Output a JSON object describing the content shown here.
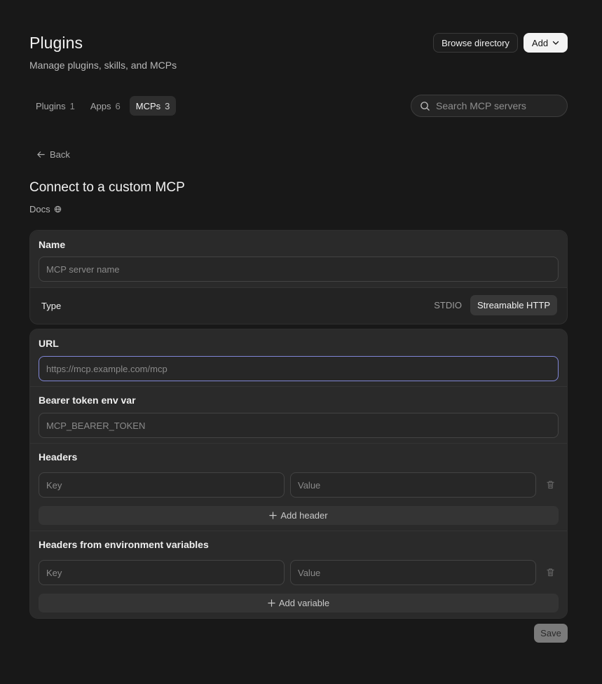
{
  "header": {
    "title": "Plugins",
    "subtitle": "Manage plugins, skills, and MCPs",
    "browse_label": "Browse directory",
    "add_label": "Add"
  },
  "tabs": [
    {
      "label": "Plugins",
      "count": "1",
      "active": false
    },
    {
      "label": "Apps",
      "count": "6",
      "active": false
    },
    {
      "label": "MCPs",
      "count": "3",
      "active": true
    }
  ],
  "search": {
    "placeholder": "Search MCP servers",
    "value": ""
  },
  "back_label": "Back",
  "section": {
    "title": "Connect to a custom MCP",
    "docs_label": "Docs"
  },
  "form": {
    "name": {
      "label": "Name",
      "placeholder": "MCP server name"
    },
    "type": {
      "label": "Type",
      "options": [
        "STDIO",
        "Streamable HTTP"
      ],
      "selected": "Streamable HTTP"
    },
    "url": {
      "label": "URL",
      "placeholder": "https://mcp.example.com/mcp"
    },
    "bearer": {
      "label": "Bearer token env var",
      "placeholder": "MCP_BEARER_TOKEN"
    },
    "headers": {
      "label": "Headers",
      "key_placeholder": "Key",
      "value_placeholder": "Value",
      "add_label": "Add header"
    },
    "env_headers": {
      "label": "Headers from environment variables",
      "key_placeholder": "Key",
      "value_placeholder": "Value",
      "add_label": "Add variable"
    }
  },
  "save_label": "Save",
  "colors": {
    "background": "#181818",
    "card": "#232323",
    "focus": "#8086d6",
    "primary_button": "#f3f3f3"
  }
}
